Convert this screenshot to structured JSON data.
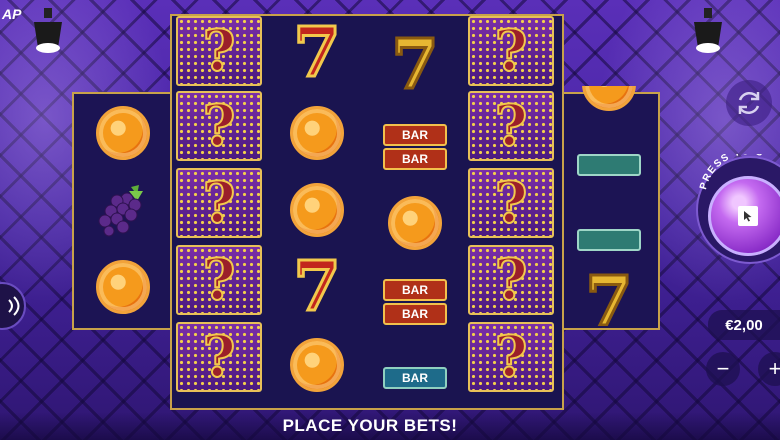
{
  "brand": "AP",
  "status": {
    "message": "PLACE YOUR BETS!"
  },
  "spin_button": {
    "arc_label": "PRESS TO S"
  },
  "bet": {
    "value": "€2,00",
    "minus": "−",
    "plus": "+"
  },
  "symbols": {
    "mystery": "?",
    "seven": "7",
    "bar": "BAR"
  },
  "colors": {
    "background": "#4524a0",
    "frame_gold": "#c8a24a",
    "spin_purple": "#a24de0"
  },
  "icons": [
    "spotlight-icon",
    "refresh-icon",
    "sound-icon",
    "cursor-icon"
  ]
}
